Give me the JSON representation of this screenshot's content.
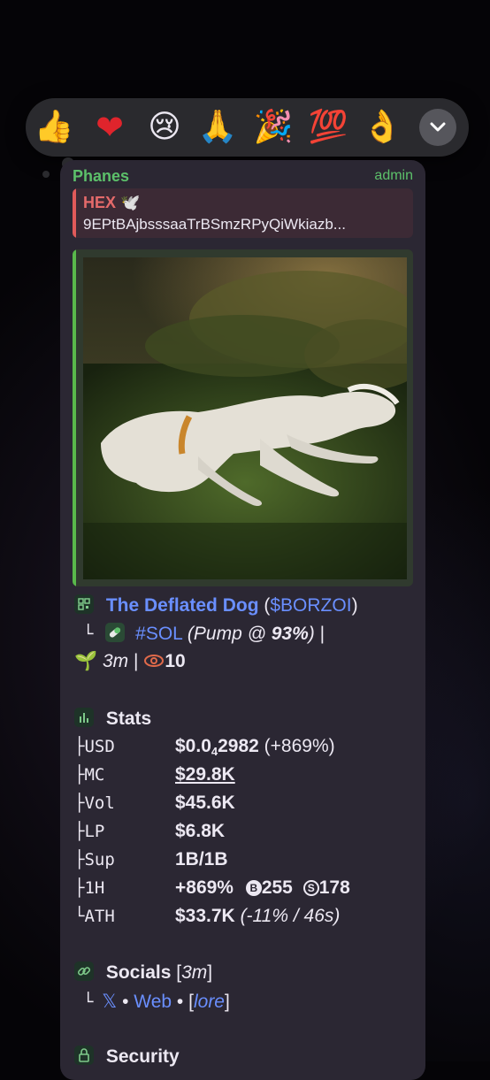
{
  "reactions": [
    {
      "icon": "thumbs-up-icon",
      "glyph": "👍"
    },
    {
      "icon": "red-heart-icon",
      "glyph": "❤️"
    },
    {
      "icon": "crying-face-icon",
      "glyph": "😢"
    },
    {
      "icon": "folded-hands-icon",
      "glyph": "🙏"
    },
    {
      "icon": "party-popper-icon",
      "glyph": "🎉"
    },
    {
      "icon": "hundred-points-icon",
      "glyph": "💯"
    },
    {
      "icon": "ok-hand-icon",
      "glyph": "👌"
    }
  ],
  "message": {
    "sender": "Phanes",
    "role": "admin",
    "reply": {
      "name": "HEX",
      "name_emoji": "🕊️",
      "text": "9EPtBAjbsssaaTrBSmzRPyQiWkiazb..."
    },
    "token": {
      "name": "The Deflated Dog",
      "symbol": "$BORZOI",
      "open_paren": "(",
      "close_paren": ")",
      "tree": "└",
      "chain": "#SOL",
      "source": "(Pump @ ",
      "progress": "93%",
      "source_end": ")",
      "sep": "|",
      "age": "3m",
      "views": "10"
    },
    "stats": {
      "title": "Stats",
      "rows": [
        {
          "key": "├USD",
          "value": "$0.0",
          "sub": "4",
          "value2": "2982",
          "extra": "(+869%)"
        },
        {
          "key": "├MC",
          "value": "$29.8K"
        },
        {
          "key": "├Vol",
          "value": "$45.6K"
        },
        {
          "key": "├LP",
          "value": "$6.8K"
        },
        {
          "key": "├Sup",
          "value": "1B/1B"
        },
        {
          "key": "├1H",
          "value": "+869%",
          "buys": "255",
          "sells": "178"
        },
        {
          "key": "└ATH",
          "value": "$33.7K",
          "extra": "(-11% / 46s)"
        }
      ]
    },
    "socials": {
      "title": "Socials",
      "age": "3m",
      "tree": "└",
      "x_link": "𝕏",
      "dot": "•",
      "web": "Web",
      "lore_open": "[",
      "lore": "lore",
      "lore_close": "]"
    },
    "security": {
      "title": "Security"
    }
  },
  "colors": {
    "accent_blue": "#6a8fff",
    "sender_green": "#5cc06a",
    "reply_red": "#e46a6a",
    "bubble": "#2b2733"
  }
}
